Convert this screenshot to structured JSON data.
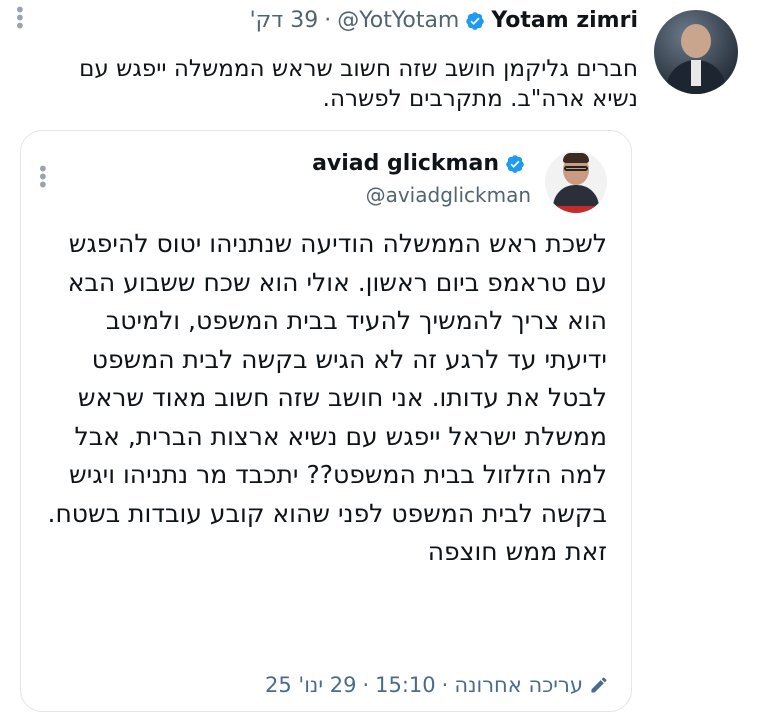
{
  "tweet": {
    "display_name": "Yotam zimri",
    "handle": "@YotYotam",
    "time": "39 דק'",
    "separator": "·",
    "text": "חברים גליקמן חושב שזה חשוב שראש הממשלה ייפגש עם נשיא ארה\"ב. מתקרבים לפשרה."
  },
  "quote": {
    "display_name": "aviad glickman",
    "handle": "@aviadglickman",
    "text": "לשכת ראש הממשלה הודיעה שנתניהו יטוס להיפגש עם טראמפ ביום ראשון. אולי הוא שכח ששבוע הבא הוא צריך להמשיך להעיד בבית המשפט, ולמיטב ידיעתי עד לרגע זה לא הגיש בקשה לבית המשפט לבטל את עדותו. אני חושב שזה חשוב מאוד שראש ממשלת ישראל ייפגש עם נשיא ארצות הברית, אבל למה הזלזול בבית המשפט?? יתכבד מר נתניהו ויגיש בקשה לבית המשפט לפני שהוא קובע עובדות בשטח. זאת ממש חוצפה",
    "edited_label": "עריכה אחרונה",
    "edited_time": "15:10",
    "edited_date": "29 ינו' 25",
    "separator": "·"
  },
  "colors": {
    "verified": "#1d9bf0",
    "muted": "#536471",
    "footer": "#4a6c8c"
  },
  "icons": [
    "verified-badge-icon",
    "more-options-icon",
    "pencil-icon"
  ]
}
